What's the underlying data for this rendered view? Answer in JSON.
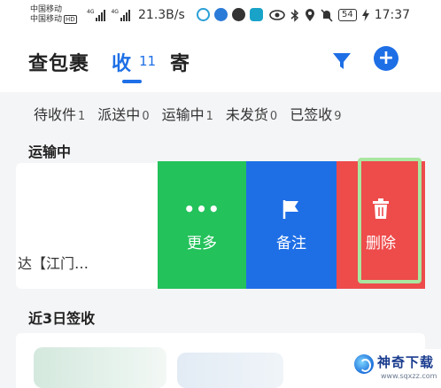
{
  "status_bar": {
    "carrier_1": "中国移动",
    "carrier_2": "中国移动",
    "hd_badge": "HD",
    "signal_tag": "4G",
    "net_speed": "21.3B/s",
    "battery": "54",
    "time": "17:37",
    "icons": [
      "app-icon",
      "app-icon",
      "app-icon",
      "app-icon",
      "eye-icon",
      "bluetooth-icon",
      "location-icon",
      "mute-icon"
    ]
  },
  "header": {
    "app_title": "查包裹",
    "tab_receive_label": "收",
    "tab_receive_count": "11",
    "tab_send_label": "寄",
    "filter_icon": "filter-icon",
    "add_icon": "plus-icon",
    "add_label": "+",
    "accent_color": "#1e6fe6"
  },
  "filter_chips": [
    {
      "label": "待收件",
      "count": "1"
    },
    {
      "label": "派送中",
      "count": "0"
    },
    {
      "label": "运输中",
      "count": "1"
    },
    {
      "label": "未发货",
      "count": "0"
    },
    {
      "label": "已签收",
      "count": "9"
    }
  ],
  "in_transit": {
    "section_title": "运输中",
    "card_text": "达【江门…",
    "actions": {
      "more": {
        "label": "更多",
        "glyph": "•••",
        "color": "#23c25b"
      },
      "note": {
        "label": "备注",
        "icon": "flag-icon",
        "color": "#1e6fe6"
      },
      "delete": {
        "label": "删除",
        "icon": "trash-icon",
        "color": "#ee4b4b"
      }
    },
    "highlight_color": "#a9e6a0"
  },
  "recent": {
    "section_title": "近3日签收"
  },
  "watermark": {
    "name": "神奇下载",
    "url": "www.sqxzz.com"
  }
}
